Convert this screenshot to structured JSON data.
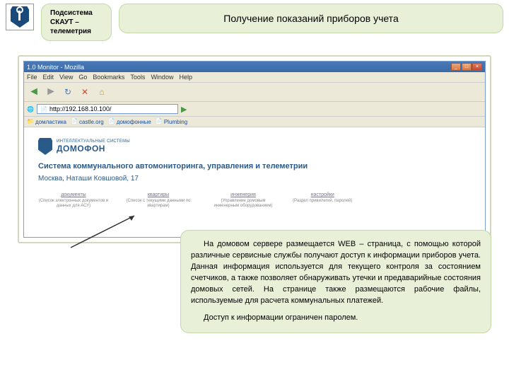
{
  "header": {
    "subtitle_line1": "Подсистема",
    "subtitle_line2": "СКАУТ –",
    "subtitle_line3": "телеметрия",
    "title": "Получение показаний приборов учета"
  },
  "browser": {
    "window_title": "1.0 Monitor - Mozilla",
    "menu": [
      "File",
      "Edit",
      "View",
      "Go",
      "Bookmarks",
      "Tools",
      "Window",
      "Help"
    ],
    "address": "http://192.168.10.100/",
    "bookmarks": [
      "домластика",
      "castle.org",
      "домофонные",
      "Plumbing"
    ]
  },
  "page": {
    "logo_sub": "ИНТЕЛЛЕКТУАЛЬНЫЕ СИСТЕМЫ",
    "logo_text": "ДОМОФОН",
    "title": "Система коммунального автомониторинга, управления и телеметрии",
    "address": "Москва, Наташи Ковшовой, 17",
    "tabs": [
      {
        "head": "документы",
        "desc": "(Список электронных документов и данных для АСУ)"
      },
      {
        "head": "квартиры",
        "desc": "(Список с текущими данными по квартирам)"
      },
      {
        "head": "инженерия",
        "desc": "(Управление домовым инженерным оборудованием)"
      },
      {
        "head": "настройки",
        "desc": "(Раздел привилегий, паролей)"
      }
    ]
  },
  "description": {
    "p1": "На домовом сервере размещается WEB – страница, с помощью которой различные сервисные службы получают доступ к информации приборов учета. Данная информация используется для текущего контроля за состоянием счетчиков, а также позволяет обнаруживать утечки и предаварийные состояния домовых сетей. На странице также размещаются рабочие файлы, используемые для расчета коммунальных платежей.",
    "p2": "Доступ к информации ограничен паролем."
  }
}
